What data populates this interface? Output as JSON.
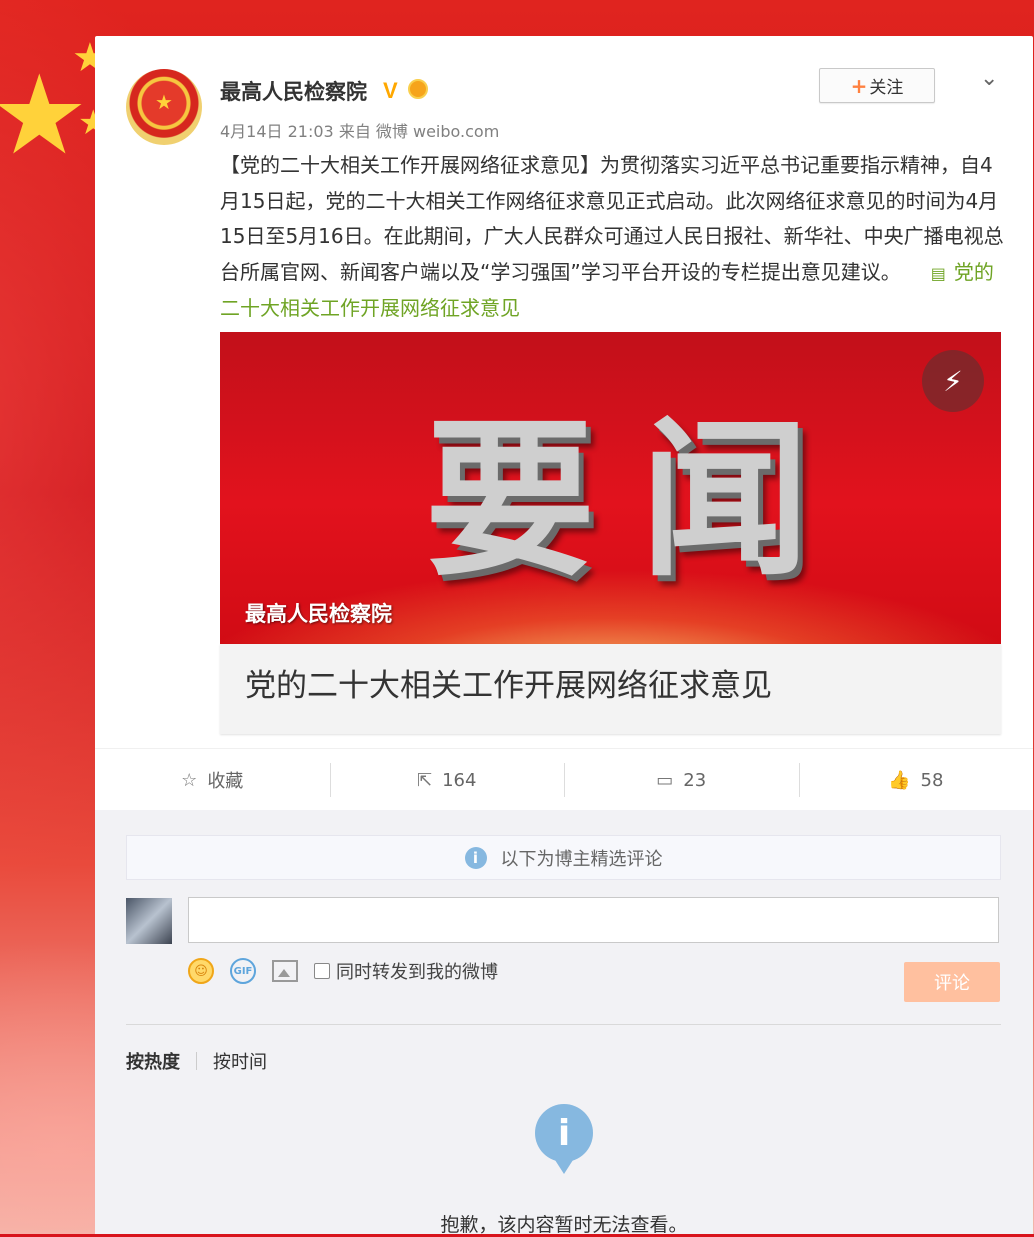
{
  "post": {
    "author": "最高人民检察院",
    "meta": "4月14日 21:03 来自 微博 weibo.com",
    "follow_label": "关注",
    "text": "【党的二十大相关工作开展网络征求意见】为贯彻落实习近平总书记重要指示精神，自4月15日起，党的二十大相关工作网络征求意见正式启动。此次网络征求意见的时间为4月15日至5月16日。在此期间，广大人民群众可通过人民日报社、新华社、中央广播电视总台所属官网、新闻客户端以及“学习强国”学习平台开设的专栏提出意见建议。",
    "link_text": "党的二十大相关工作开展网络征求意见",
    "media_title": "要闻",
    "media_source": "最高人民检察院",
    "card_caption": "党的二十大相关工作开展网络征求意见"
  },
  "actions": {
    "favorite": "收藏",
    "repost": "164",
    "comment": "23",
    "like": "58"
  },
  "comments": {
    "notice": "以下为博主精选评论",
    "sync_label": "同时转发到我的微博",
    "submit": "评论",
    "sort_hot": "按热度",
    "sort_time": "按时间",
    "empty_message": "抱歉，该内容暂时无法查看。"
  },
  "colors": {
    "link": "#6fa425",
    "submit_bg": "#ffc09f",
    "info_icon": "#86b8e0"
  }
}
